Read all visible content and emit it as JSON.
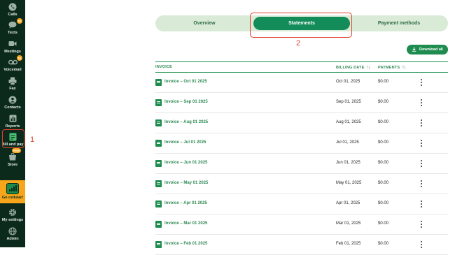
{
  "sidebar": {
    "items": [
      {
        "label": "Calls",
        "icon": "phone-icon"
      },
      {
        "label": "Texts",
        "icon": "chat-icon",
        "badge": "12"
      },
      {
        "label": "Meetings",
        "icon": "video-icon"
      },
      {
        "label": "Voicemail",
        "icon": "voicemail-icon",
        "badge": "12"
      },
      {
        "label": "Fax",
        "icon": "fax-icon"
      },
      {
        "label": "Contacts",
        "icon": "contacts-icon"
      },
      {
        "label": "Reports",
        "icon": "reports-icon"
      },
      {
        "label": "Bill and pay",
        "icon": "bill-icon"
      },
      {
        "label": "Store",
        "icon": "store-icon",
        "new_badge": "New"
      },
      {
        "label": "Go cellular!",
        "icon": "cellular-icon"
      },
      {
        "label": "My settings",
        "icon": "gear-icon"
      },
      {
        "label": "Admin",
        "icon": "globe-icon"
      }
    ]
  },
  "annotations": {
    "one": "1",
    "two": "2"
  },
  "tabs": [
    {
      "label": "Overview",
      "active": false
    },
    {
      "label": "Statements",
      "active": true
    },
    {
      "label": "Payment methods",
      "active": false
    }
  ],
  "download_all": "Download all",
  "table": {
    "headers": {
      "invoice": "INVOICE",
      "billing_date": "BILLING DATE",
      "payments": "PAYMENTS"
    },
    "rows": [
      {
        "invoice": "Invoice – Oct 01 2025",
        "date": "Oct 01, 2025",
        "payment": "$0.00"
      },
      {
        "invoice": "Invoice – Sep 01 2025",
        "date": "Sep 01, 2025",
        "payment": "$0.00"
      },
      {
        "invoice": "Invoice – Aug 01 2025",
        "date": "Aug 01, 2025",
        "payment": "$0.00"
      },
      {
        "invoice": "Invoice – Jul 01 2025",
        "date": "Jul 01, 2025",
        "payment": "$0.00"
      },
      {
        "invoice": "Invoice – Jun 01 2025",
        "date": "Jun 01, 2025",
        "payment": "$0.00"
      },
      {
        "invoice": "Invoice – May 01 2025",
        "date": "May 01, 2025",
        "payment": "$0.00"
      },
      {
        "invoice": "Invoice – Apr 01 2025",
        "date": "Apr 01, 2025",
        "payment": "$0.00"
      },
      {
        "invoice": "Invoice – Mar 01 2025",
        "date": "Mar 01, 2025",
        "payment": "$0.00"
      },
      {
        "invoice": "Invoice – Feb 01 2025",
        "date": "Feb 01, 2025",
        "payment": "$0.00"
      }
    ]
  },
  "colors": {
    "brand_green": "#1d8c4e",
    "sidebar_bg": "#0b2a1c",
    "accent_orange": "#f7a51b",
    "annotation_red": "#e0402d"
  }
}
